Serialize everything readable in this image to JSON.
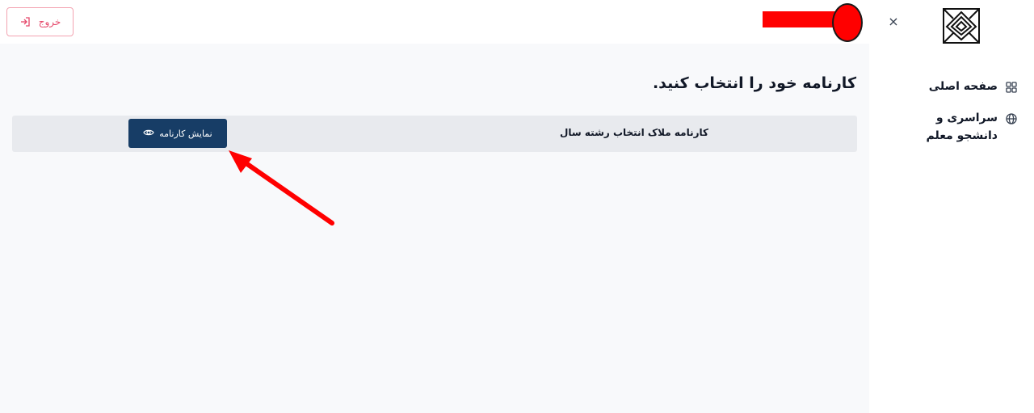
{
  "header": {
    "logout_label": "خروج",
    "logout_icon": "logout-icon",
    "redaction_color": "#ff0000"
  },
  "sidebar": {
    "close_label": "×",
    "logo_icon": "brand-logo-icon",
    "items": [
      {
        "label": "صفحه اصلی",
        "icon": "dashboard-grid-icon"
      },
      {
        "label": "سراسری و دانشجو معلم",
        "icon": "globe-icon"
      }
    ]
  },
  "main": {
    "title": "کارنامه خود را انتخاب کنید.",
    "report_card": {
      "title": "کارنامه ملاک انتخاب رشته سال",
      "button_label": "نمایش کارنامه",
      "button_icon": "eye-icon"
    }
  },
  "colors": {
    "accent": "#173d66",
    "logout": "#e5486a",
    "annotation": "#ff0000"
  }
}
